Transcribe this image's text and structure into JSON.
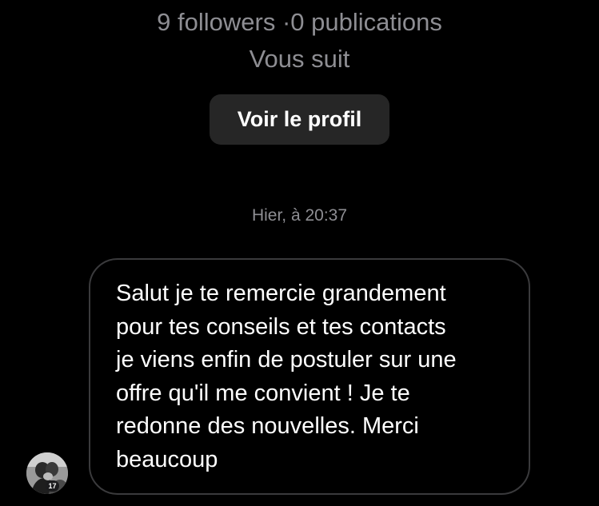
{
  "profile": {
    "stats": "9 followers ·0 publications",
    "follow_status": "Vous suit",
    "view_profile_label": "Voir le profil"
  },
  "thread": {
    "timestamp": "Hier, à 20:37",
    "messages": [
      {
        "text": "Salut je te remercie grandement\npour tes conseils et tes contacts\nje viens enfin de postuler sur une\noffre qu'il me convient ! Je te\nredonne des nouvelles. Merci\nbeaucoup"
      }
    ]
  },
  "sender": {
    "avatar_badge": "17"
  },
  "colors": {
    "background": "#000000",
    "secondary_text": "#8e8e93",
    "button_background": "#262626",
    "bubble_border": "#3a3a3c",
    "primary_text": "#ffffff"
  }
}
